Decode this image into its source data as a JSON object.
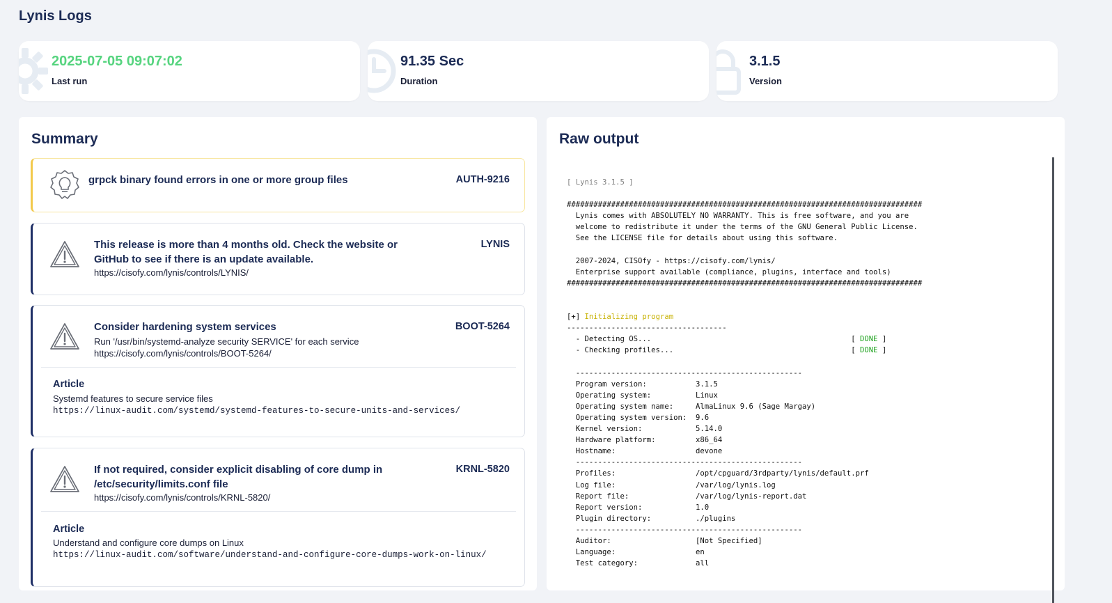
{
  "page": {
    "title": "Lynis Logs"
  },
  "stats": [
    {
      "value": "2025-07-05 09:07:02",
      "label": "Last run",
      "icon": "gear-icon",
      "color": "#56d47f"
    },
    {
      "value": "91.35 Sec",
      "label": "Duration",
      "icon": "clock-icon",
      "color": "#1c2b55"
    },
    {
      "value": "3.1.5",
      "label": "Version",
      "icon": "lock-icon",
      "color": "#1c2b55"
    }
  ],
  "summary": {
    "title": "Summary",
    "findings": [
      {
        "type": "suggestion",
        "icon": "lightbulb-icon",
        "title": "grpck binary found errors in one or more group files",
        "code": "AUTH-9216"
      },
      {
        "type": "warning",
        "icon": "warning-icon",
        "title": "This release is more than 4 months old. Check the website or GitHub to see if there is an update available.",
        "code": "LYNIS",
        "link": "https://cisofy.com/lynis/controls/LYNIS/"
      },
      {
        "type": "warning",
        "icon": "warning-icon",
        "title": "Consider hardening system services",
        "code": "BOOT-5264",
        "details": "Run '/usr/bin/systemd-analyze security SERVICE' for each service",
        "link": "https://cisofy.com/lynis/controls/BOOT-5264/",
        "article": {
          "heading": "Article",
          "description": "Systemd features to secure service files",
          "url": "https://linux-audit.com/systemd/systemd-features-to-secure-units-and-services/"
        }
      },
      {
        "type": "warning",
        "icon": "warning-icon",
        "title": "If not required, consider explicit disabling of core dump in /etc/security/limits.conf file",
        "code": "KRNL-5820",
        "link": "https://cisofy.com/lynis/controls/KRNL-5820/",
        "article": {
          "heading": "Article",
          "description": "Understand and configure core dumps on Linux",
          "url": "https://linux-audit.com/software/understand-and-configure-core-dumps-work-on-linux/"
        }
      }
    ]
  },
  "raw_output": {
    "title": "Raw output",
    "version_line": "[ Lynis 3.1.5 ]",
    "banner": "################################################################################\n  Lynis comes with ABSOLUTELY NO WARRANTY. This is free software, and you are\n  welcome to redistribute it under the terms of the GNU General Public License.\n  See the LICENSE file for details about using this software.\n\n  2007-2024, CISOfy - https://cisofy.com/lynis/\n  Enterprise support available (compliance, plugins, interface and tools)\n################################################################################",
    "section_prefix": "[+] ",
    "section_title": "Initializing program",
    "section_rule": "------------------------------------",
    "checks": [
      {
        "label": "  - Detecting OS...                                             [ ",
        "status": "DONE",
        "suffix": " ]"
      },
      {
        "label": "  - Checking profiles...                                        [ ",
        "status": "DONE",
        "suffix": " ]"
      }
    ],
    "info": "  ---------------------------------------------------\n  Program version:           3.1.5\n  Operating system:          Linux\n  Operating system name:     AlmaLinux 9.6 (Sage Margay)\n  Operating system version:  9.6\n  Kernel version:            5.14.0\n  Hardware platform:         x86_64\n  Hostname:                  devone\n  ---------------------------------------------------\n  Profiles:                  /opt/cpguard/3rdparty/lynis/default.prf\n  Log file:                  /var/log/lynis.log\n  Report file:               /var/log/lynis-report.dat\n  Report version:            1.0\n  Plugin directory:          ./plugins\n  ---------------------------------------------------\n  Auditor:                   [Not Specified]\n  Language:                  en\n  Test category:             all"
  }
}
